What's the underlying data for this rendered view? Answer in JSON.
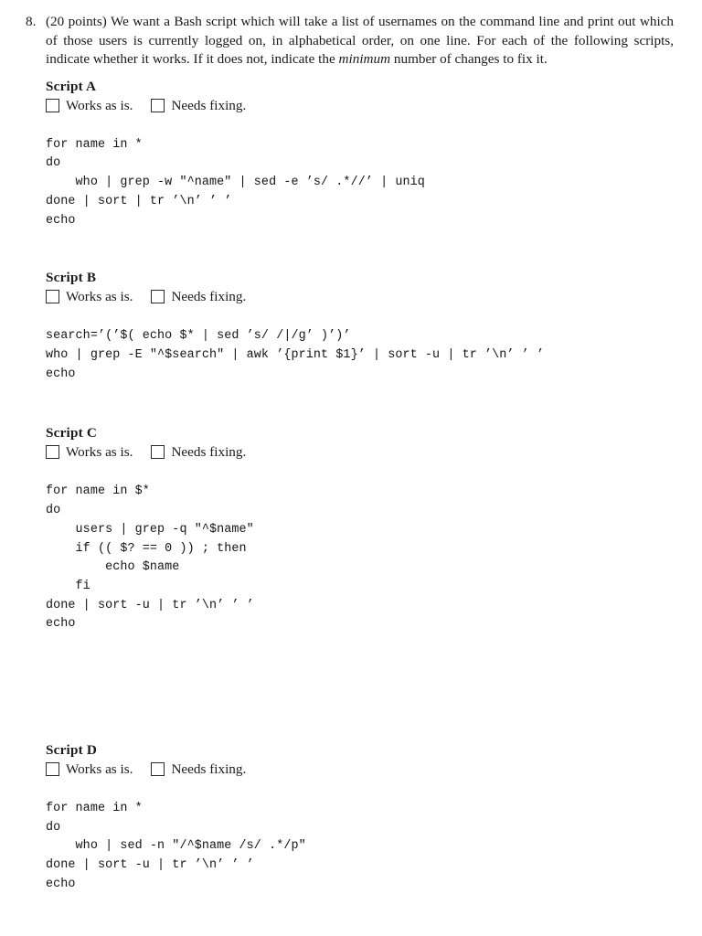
{
  "problem": {
    "number": "8.",
    "text_before_italic": "(20 points) We want a Bash script which will take a list of usernames on the command line and print out which of those users is currently logged on, in alphabetical order, on one line. For each of the following scripts, indicate whether it works. If it does not, indicate the ",
    "italic_word": "minimum",
    "text_after_italic": " number of changes to fix it."
  },
  "choice_labels": {
    "works": "Works as is.",
    "needs_fixing": "Needs fixing."
  },
  "sections": [
    {
      "title": "Script A",
      "code": "for name in *\ndo\n    who | grep -w \"^name\" | sed -e ’s/ .*//’ | uniq\ndone | sort | tr ’\\n’ ’ ’\necho"
    },
    {
      "title": "Script B",
      "code": "search=’(’$( echo $* | sed ’s/ /|/g’ )’)’\nwho | grep -E \"^$search\" | awk ’{print $1}’ | sort -u | tr ’\\n’ ’ ’\necho"
    },
    {
      "title": "Script C",
      "code": "for name in $*\ndo\n    users | grep -q \"^$name\"\n    if (( $? == 0 )) ; then\n        echo $name\n    fi\ndone | sort -u | tr ’\\n’ ’ ’\necho"
    },
    {
      "title": "Script D",
      "code": "for name in *\ndo\n    who | sed -n \"/^$name /s/ .*/p\"\ndone | sort -u | tr ’\\n’ ’ ’\necho"
    }
  ]
}
